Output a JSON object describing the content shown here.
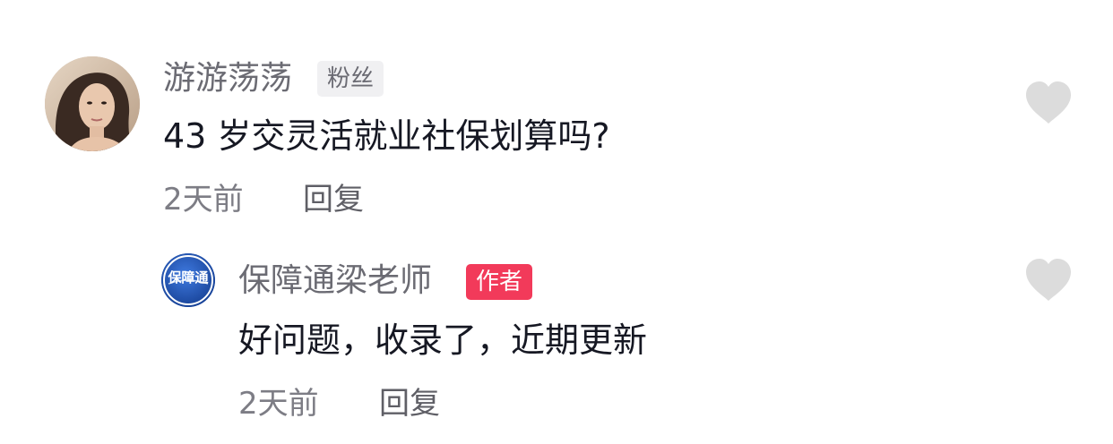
{
  "comments": [
    {
      "username": "游游荡荡",
      "badge": "粉丝",
      "text": "43 岁交灵活就业社保划算吗?",
      "time": "2天前",
      "reply_label": "回复",
      "avatar_icon": "user-photo-avatar",
      "like_icon": "heart-icon"
    },
    {
      "username": "保障通梁老师",
      "badge": "作者",
      "text": "好问题，收录了，近期更新",
      "time": "2天前",
      "reply_label": "回复",
      "avatar_icon": "brand-logo-avatar",
      "avatar_text": "保障通",
      "like_icon": "heart-icon"
    }
  ],
  "colors": {
    "author_badge": "#f23a5a",
    "fan_badge_bg": "#f0f0f2",
    "heart": "#dcdcdc",
    "logo_blue": "#1f4fb0"
  }
}
